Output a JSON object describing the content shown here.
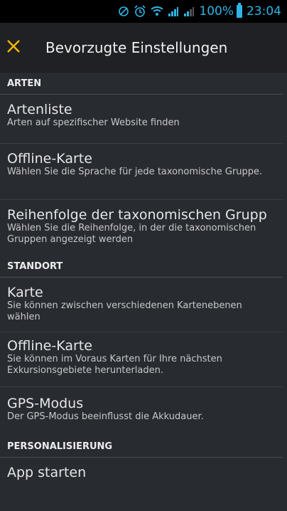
{
  "status_bar": {
    "battery_text": "100%",
    "time": "23:04"
  },
  "toolbar": {
    "title": "Bevorzugte Einstellungen",
    "close_icon": "close-icon",
    "accent_color": "#f5b800"
  },
  "sections": [
    {
      "header": "ARTEN",
      "items": [
        {
          "title": "Artenliste",
          "subtitle": "Arten auf spezifischer Website finden"
        },
        {
          "title": "Eingabesprache",
          "subtitle": "Wählen Sie die Sprache für jede taxonomische Gruppe."
        },
        {
          "title": "Reihenfolge der taxonomischen Grupp",
          "subtitle": "Wählen Sie die Reihenfolge, in der die taxonomischen Gruppen angezeigt werden"
        }
      ]
    },
    {
      "header": "STANDORT",
      "items": [
        {
          "title": "Karte",
          "subtitle": "Sie können zwischen verschiedenen Kartenebenen wählen"
        },
        {
          "title": "Offline-Karte",
          "subtitle": "Sie können im Voraus Karten für Ihre nächsten Exkursionsgebiete herunterladen."
        },
        {
          "title": "GPS-Modus",
          "subtitle": "Der GPS-Modus beeinflusst die Akkudauer."
        }
      ]
    },
    {
      "header": "PERSONALISIERUNG",
      "items": [
        {
          "title": "App starten"
        }
      ]
    }
  ]
}
